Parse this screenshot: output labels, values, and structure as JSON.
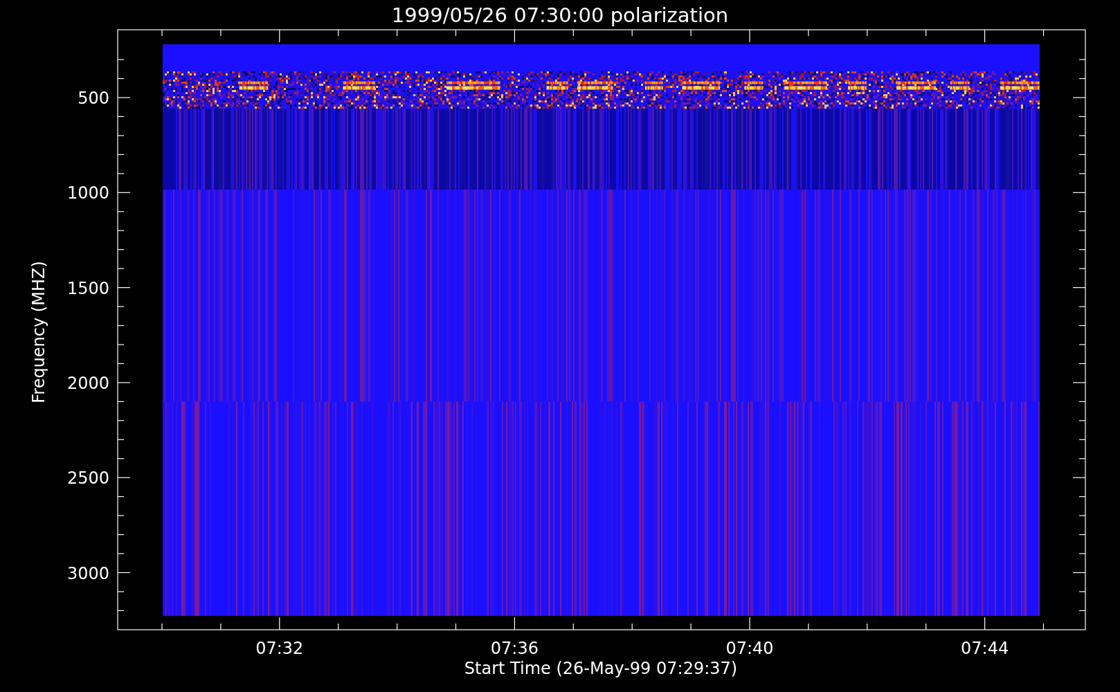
{
  "title": "1999/05/26 07:30:00 polarization",
  "y_axis": {
    "label": "Frequency (MHZ)",
    "ticks": [
      "500",
      "1000",
      "1500",
      "2000",
      "2500",
      "3000"
    ]
  },
  "x_axis": {
    "label": "Start Time (26-May-99 07:29:37)",
    "ticks": [
      "07:32",
      "07:36",
      "07:40",
      "07:44"
    ]
  }
}
